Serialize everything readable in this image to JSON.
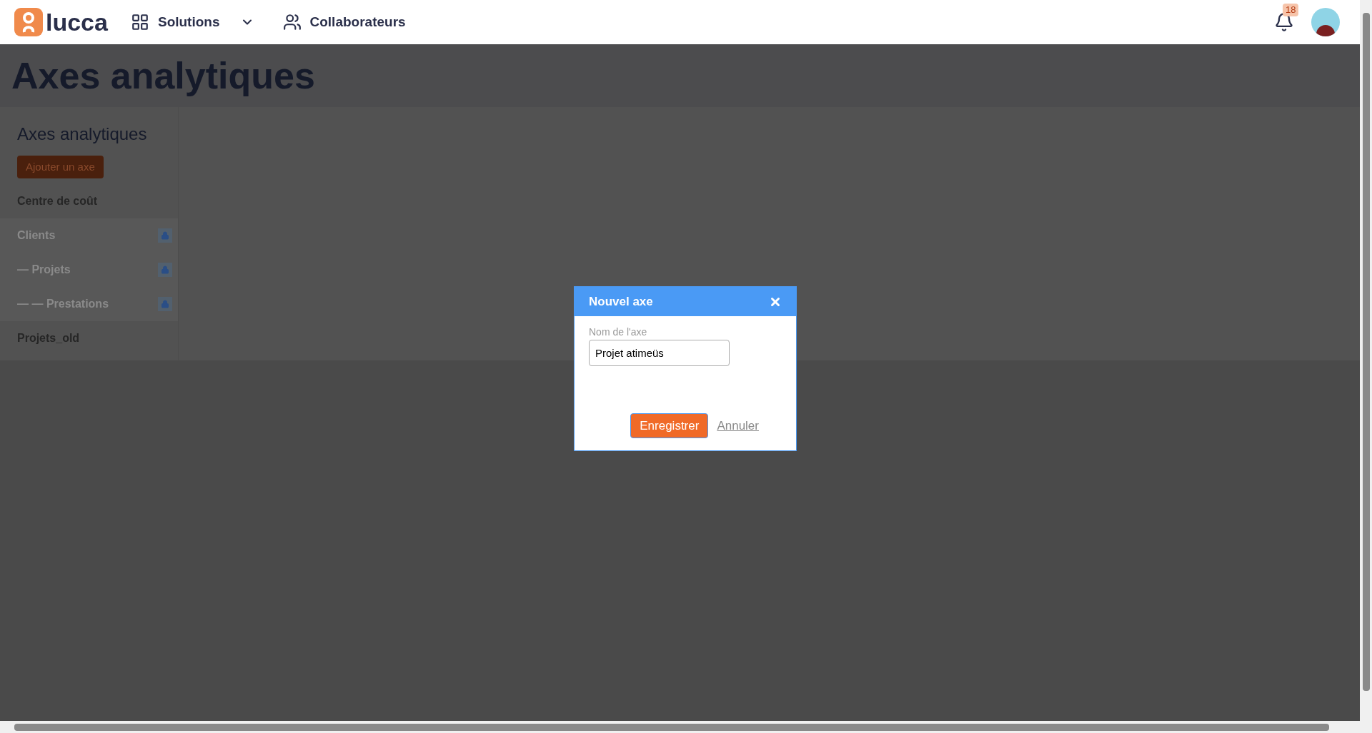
{
  "header": {
    "logo": "lucca",
    "nav": [
      {
        "kind": "menu",
        "label": "Solutions"
      },
      {
        "kind": "link",
        "label": "Collaborateurs"
      }
    ],
    "notifications": "18"
  },
  "page": {
    "title": "Axes analytiques"
  },
  "sidebar": {
    "title": "Axes analytiques",
    "add_button": "Ajouter un axe",
    "items": [
      {
        "label": "Centre de coût",
        "selected": false,
        "locked": false
      },
      {
        "label": "Clients",
        "selected": true,
        "locked": true,
        "children": [
          {
            "label": "— Projets",
            "selected": true,
            "locked": true,
            "children": [
              {
                "label": "— — Prestations",
                "selected": true,
                "locked": true
              }
            ]
          }
        ]
      },
      {
        "label": "Projets_old",
        "selected": false,
        "locked": false
      }
    ]
  },
  "dialog": {
    "title": "Nouvel axe",
    "field": {
      "label": "Nom de l'axe",
      "value": "Projet atimeüs"
    },
    "buttons": [
      {
        "kind": "primary",
        "label": "Enregistrer"
      },
      {
        "kind": "link",
        "label": "Annuler"
      }
    ]
  }
}
